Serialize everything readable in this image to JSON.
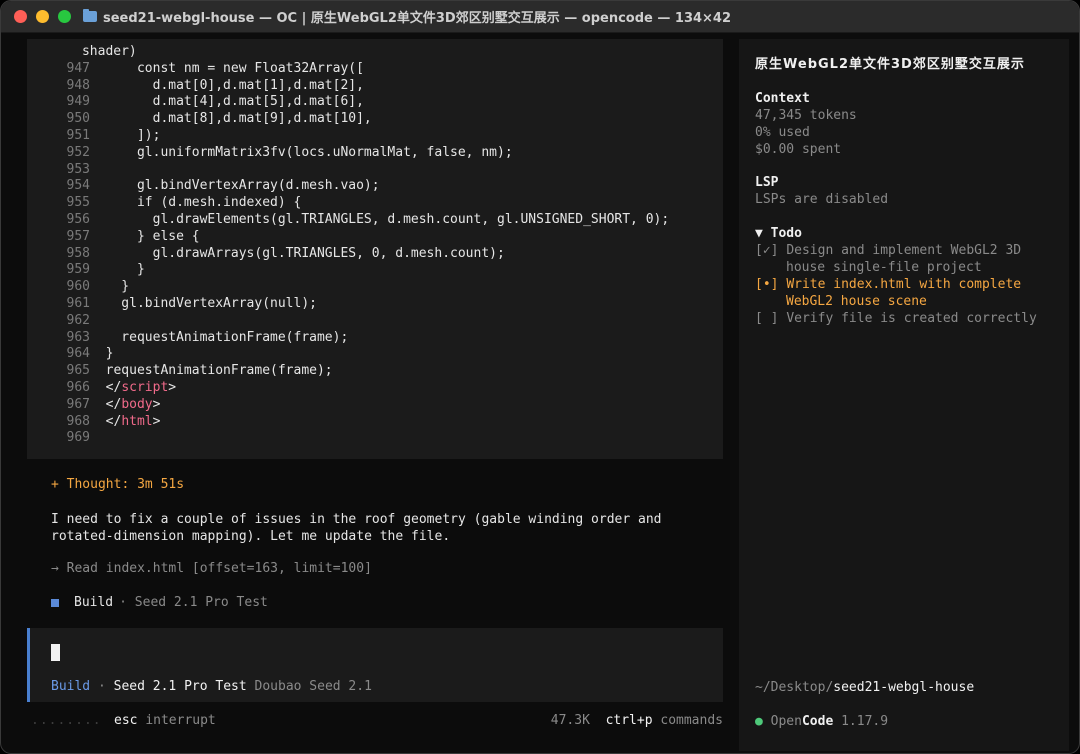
{
  "window": {
    "title": "seed21-webgl-house — OC | 原生WebGL2单文件3D郊区别墅交互展示 — opencode — 134×42"
  },
  "code": {
    "lines": [
      {
        "n": "",
        "t": "    shader)"
      },
      {
        "n": "947",
        "t": "    const nm = new Float32Array(["
      },
      {
        "n": "948",
        "t": "      d.mat[0],d.mat[1],d.mat[2],"
      },
      {
        "n": "949",
        "t": "      d.mat[4],d.mat[5],d.mat[6],"
      },
      {
        "n": "950",
        "t": "      d.mat[8],d.mat[9],d.mat[10],"
      },
      {
        "n": "951",
        "t": "    ]);"
      },
      {
        "n": "952",
        "t": "    gl.uniformMatrix3fv(locs.uNormalMat, false, nm);"
      },
      {
        "n": "953",
        "t": ""
      },
      {
        "n": "954",
        "t": "    gl.bindVertexArray(d.mesh.vao);"
      },
      {
        "n": "955",
        "t": "    if (d.mesh.indexed) {"
      },
      {
        "n": "956",
        "t": "      gl.drawElements(gl.TRIANGLES, d.mesh.count, gl.UNSIGNED_SHORT, 0);"
      },
      {
        "n": "957",
        "t": "    } else {"
      },
      {
        "n": "958",
        "t": "      gl.drawArrays(gl.TRIANGLES, 0, d.mesh.count);"
      },
      {
        "n": "959",
        "t": "    }"
      },
      {
        "n": "960",
        "t": "  }"
      },
      {
        "n": "961",
        "t": "  gl.bindVertexArray(null);"
      },
      {
        "n": "962",
        "t": ""
      },
      {
        "n": "963",
        "t": "  requestAnimationFrame(frame);"
      },
      {
        "n": "964",
        "t": "}"
      },
      {
        "n": "965",
        "t": "requestAnimationFrame(frame);"
      },
      {
        "n": "966",
        "pre": "</",
        "tag": "script",
        "post": ">"
      },
      {
        "n": "967",
        "pre": "</",
        "tag": "body",
        "post": ">"
      },
      {
        "n": "968",
        "pre": "</",
        "tag": "html",
        "post": ">"
      },
      {
        "n": "969",
        "t": ""
      }
    ]
  },
  "chat": {
    "thought": "+ Thought: 3m 51s",
    "message": "I need to fix a couple of issues in the roof geometry (gable winding order and rotated-dimension mapping). Let me update the file.",
    "tool_call": "→ Read index.html [offset=163, limit=100]",
    "build_label": "Build",
    "build_model": "· Seed 2.1 Pro Test"
  },
  "input": {
    "mode": "Build",
    "separator": "·",
    "model": "Seed 2.1 Pro Test",
    "provider": "Doubao Seed 2.1"
  },
  "status": {
    "dots": "........",
    "esc_key": "esc",
    "esc_label": "interrupt",
    "tokens": "47.3K",
    "shortcut": "ctrl+p",
    "shortcut_label": "commands"
  },
  "sidebar": {
    "title": "原生WebGL2单文件3D郊区别墅交互展示",
    "context_head": "Context",
    "tokens": "47,345 tokens",
    "used": "0% used",
    "spent": "$0.00 spent",
    "lsp_head": "LSP",
    "lsp_status": "LSPs are disabled",
    "todo_head": "▼ Todo",
    "todos": [
      {
        "mark": "[✓]",
        "line1": "Design and implement WebGL2 3D",
        "line2": "house single-file project",
        "state": "done"
      },
      {
        "mark": "[•]",
        "line1": "Write index.html with complete",
        "line2": "WebGL2 house scene",
        "state": "active"
      },
      {
        "mark": "[ ]",
        "line1": "Verify file is created correctly",
        "line2": "",
        "state": "pending"
      }
    ],
    "path_prefix": "~/Desktop/",
    "path_dir": "seed21-webgl-house",
    "app_dot": "●",
    "app_open": "Open",
    "app_code": "Code",
    "version": "1.17.9"
  }
}
